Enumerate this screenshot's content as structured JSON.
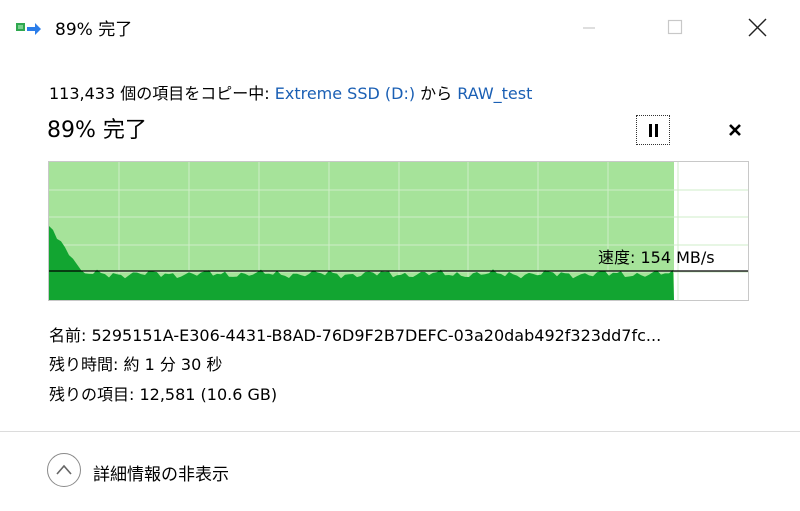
{
  "window": {
    "title": "89% 完了",
    "controls": [
      "minimize",
      "maximize",
      "close"
    ]
  },
  "copy_status": {
    "prefix": "113,433 個の項目をコピー中: ",
    "source": "Extreme SSD (D:)",
    "middle": " から ",
    "destination": "RAW_test"
  },
  "progress": {
    "title": "89% 完了",
    "fraction": 0.89
  },
  "actions": {
    "pause_icon": "pause-icon",
    "cancel_icon": "close-icon"
  },
  "graph": {
    "speed_label": "速度: 154 MB/s",
    "fill_color": "#a6e39a",
    "speed_color": "#12a531",
    "grid_color": "#cfeec8"
  },
  "details": {
    "name": "名前:  5295151A-E306-4431-B8AD-76D9F2B7DEFC-03a20dab492f323dd7fc...",
    "time_remaining": "残り時間:  約 1 分 30 秒",
    "items_remaining": "残りの項目:  12,581 (10.6 GB)"
  },
  "footer": {
    "toggle_label": "詳細情報の非表示",
    "toggle_icon": "chevron-up-icon"
  }
}
